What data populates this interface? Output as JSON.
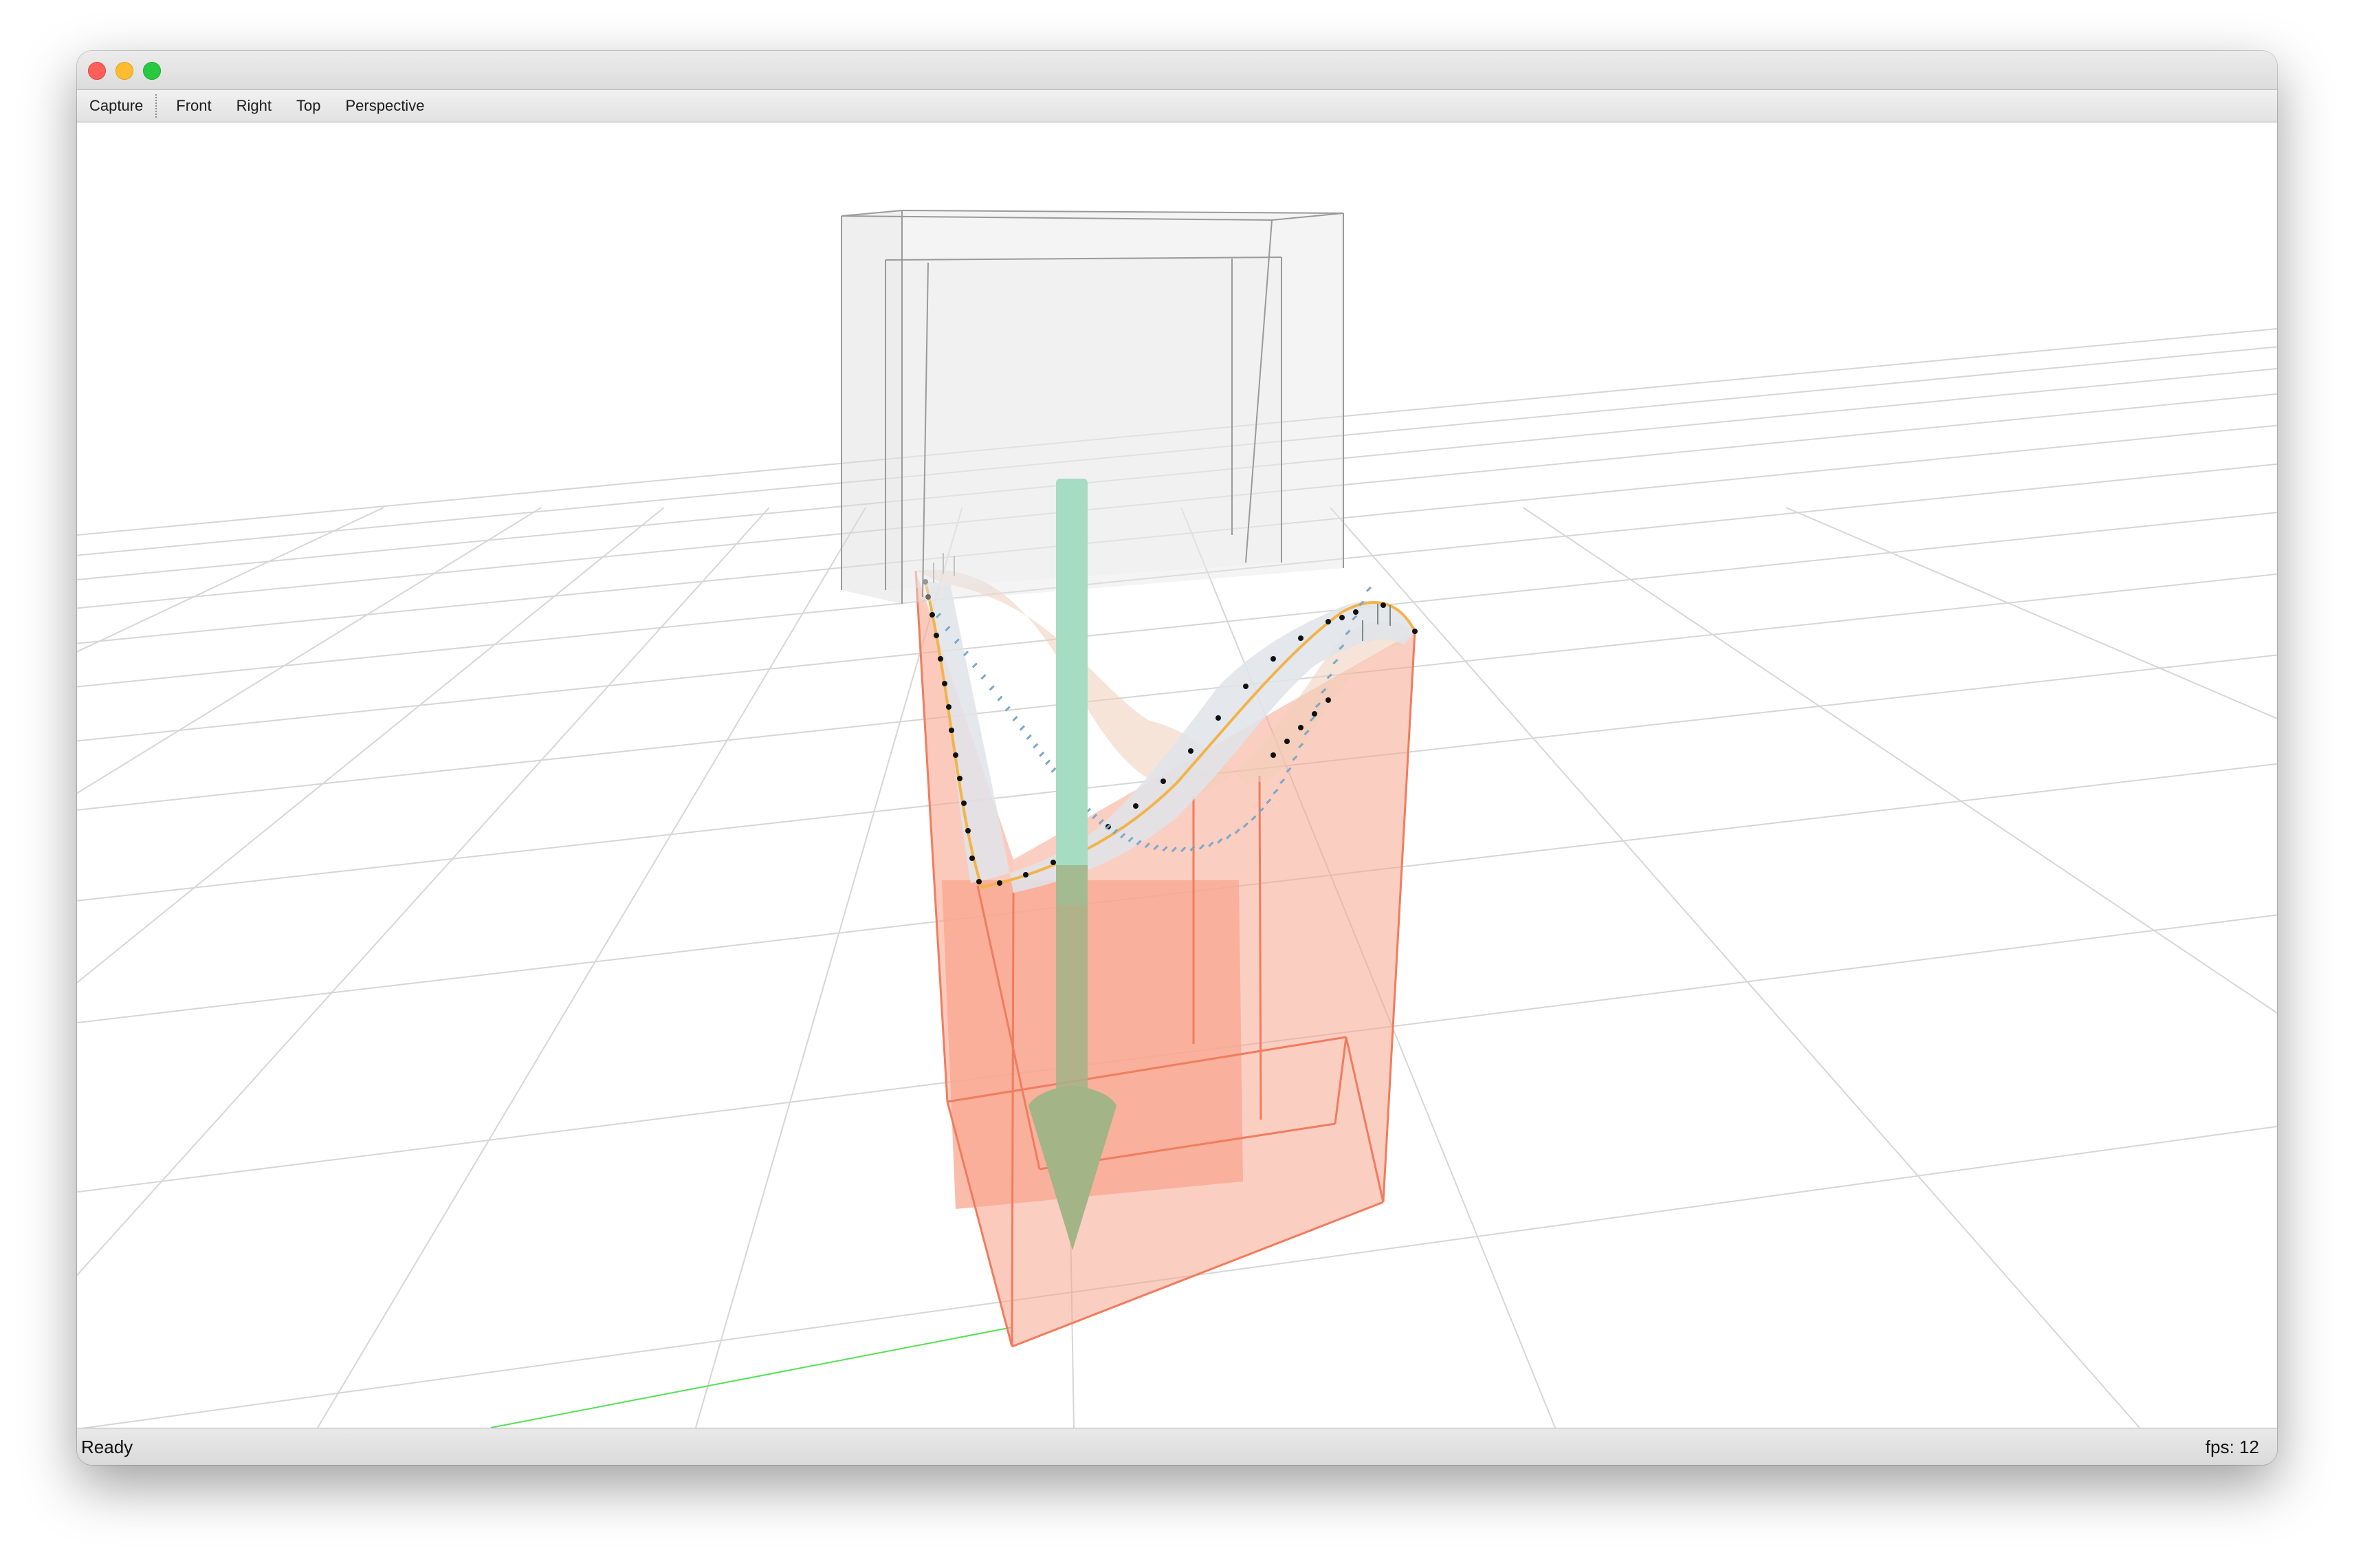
{
  "menu": {
    "items": [
      {
        "id": "capture",
        "label": "Capture"
      },
      {
        "id": "front",
        "label": "Front"
      },
      {
        "id": "right",
        "label": "Right"
      },
      {
        "id": "top",
        "label": "Top"
      },
      {
        "id": "perspective",
        "label": "Perspective"
      }
    ]
  },
  "status": {
    "message": "Ready",
    "fps_label": "fps:",
    "fps_value": "12"
  },
  "scene": {
    "colors": {
      "grid": "#d6d6d6",
      "axis": "#55e055",
      "upper_box": "#9a9a9a",
      "lower_box": "#f07c5e",
      "lower_fill": "#f8a68f",
      "surface": "#f0cdb8",
      "arrow_shaft": "#a6dcc2",
      "arrow_head": "#a3b487",
      "outline": "#f2b34a"
    },
    "icons": [
      "close-icon",
      "minimize-icon",
      "maximize-icon"
    ]
  }
}
